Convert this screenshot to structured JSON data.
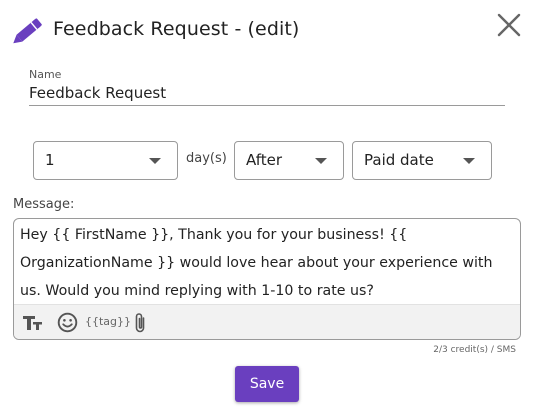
{
  "colors": {
    "accent": "#6a3fbf",
    "border": "#9a9a9a",
    "toolbar_bg": "#f2f2f2"
  },
  "header": {
    "title": "Feedback Request - (edit)",
    "icon": "pencil-icon",
    "close_icon": "close-icon"
  },
  "name_field": {
    "label": "Name",
    "value": "Feedback Request"
  },
  "schedule": {
    "count": "1",
    "unit_label": "day(s)",
    "relation": "After",
    "reference": "Paid date"
  },
  "message": {
    "label": "Message:",
    "text": "Hey {{ FirstName }}, Thank you for your business! {{ OrganizationName }} would love hear about your experience with us. Would you mind replying with 1-10 to rate us?",
    "toolbar": {
      "text_format_icon": "text-format-icon",
      "emoji_icon": "emoji-icon",
      "tag_label": "{{tag}}",
      "attach_icon": "paperclip-icon"
    }
  },
  "credits": "2/3 credit(s) / SMS",
  "save_label": "Save"
}
